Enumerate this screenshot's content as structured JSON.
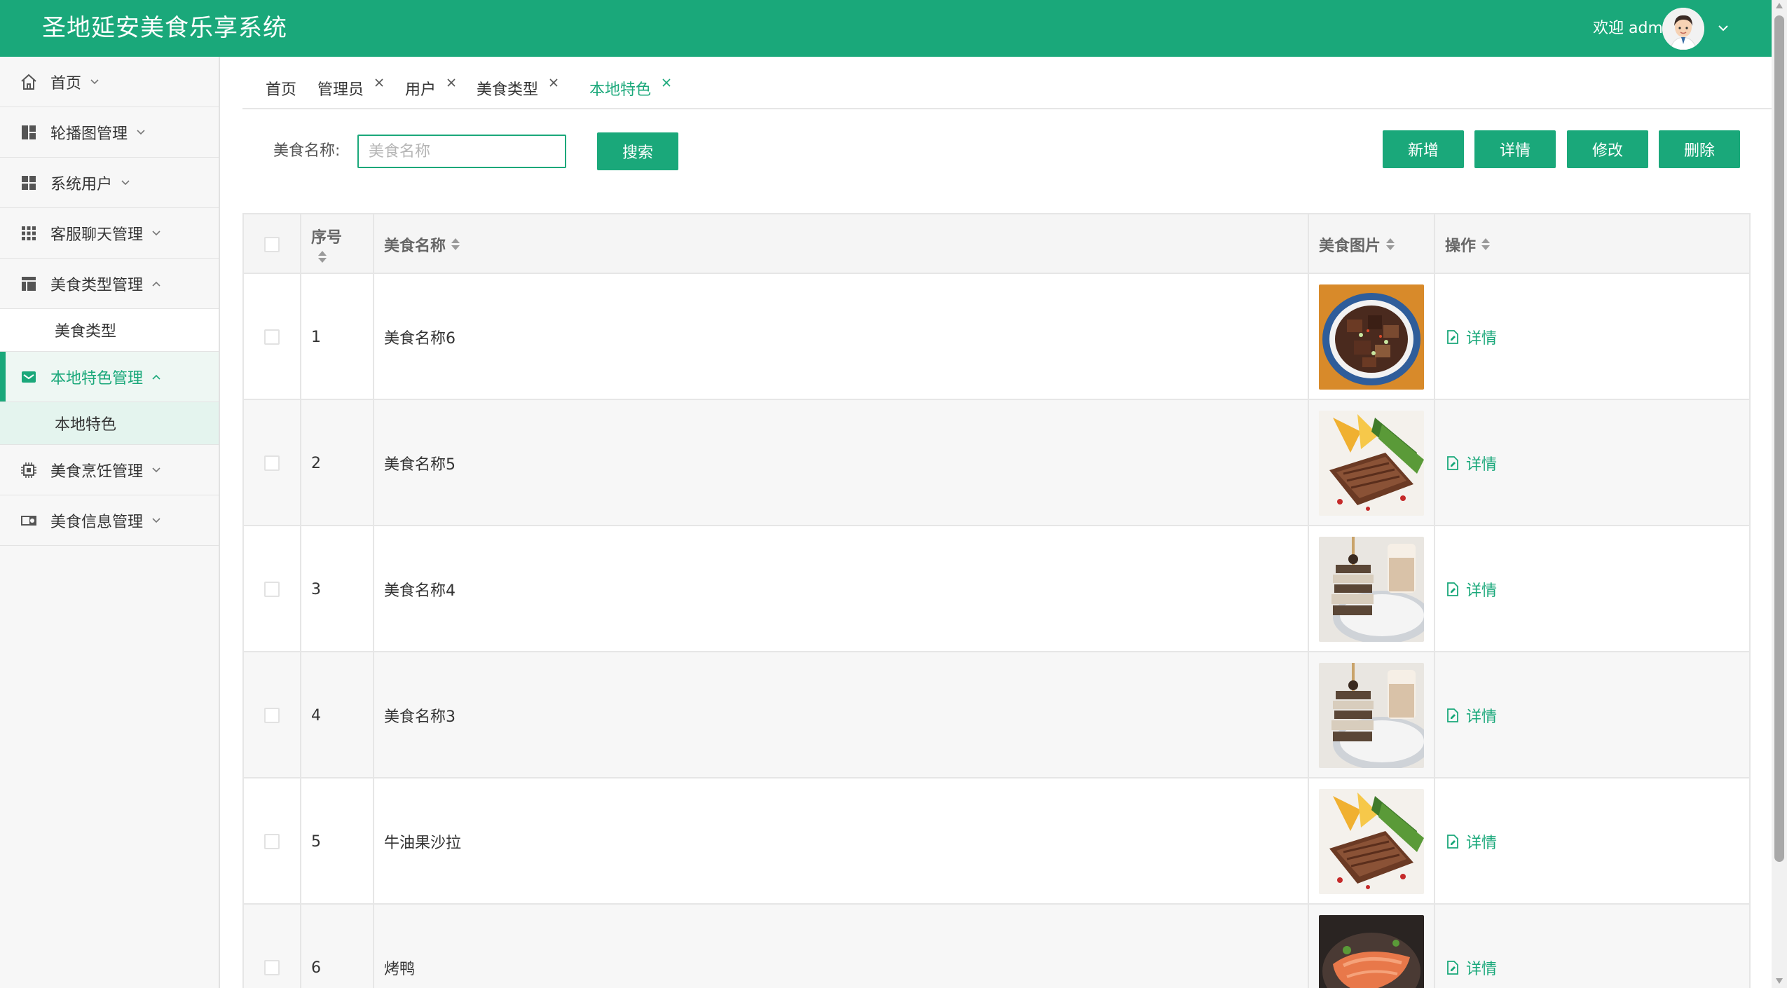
{
  "header": {
    "title": "圣地延安美食乐享系统",
    "welcome": "欢迎 admin",
    "brand_color": "#1aa87a"
  },
  "sidebar": {
    "items": [
      {
        "label": "首页",
        "icon": "home-icon",
        "expanded": false
      },
      {
        "label": "轮播图管理",
        "icon": "dashboard-icon",
        "expanded": false
      },
      {
        "label": "系统用户",
        "icon": "grid-icon",
        "expanded": false
      },
      {
        "label": "客服聊天管理",
        "icon": "apps-icon",
        "expanded": false
      },
      {
        "label": "美食类型管理",
        "icon": "layout-icon",
        "expanded": true,
        "children": [
          "美食类型"
        ]
      },
      {
        "label": "本地特色管理",
        "icon": "mail-icon",
        "expanded": true,
        "active": true,
        "children": [
          "本地特色"
        ]
      },
      {
        "label": "美食烹饪管理",
        "icon": "chip-icon",
        "expanded": false
      },
      {
        "label": "美食信息管理",
        "icon": "toggle-icon",
        "expanded": false
      }
    ]
  },
  "tabs": [
    {
      "label": "首页",
      "closable": false
    },
    {
      "label": "管理员",
      "closable": true
    },
    {
      "label": "用户",
      "closable": true
    },
    {
      "label": "美食类型",
      "closable": true
    },
    {
      "label": "本地特色",
      "closable": true,
      "active": true
    }
  ],
  "search": {
    "label": "美食名称:",
    "placeholder": "美食名称",
    "value": "",
    "button": "搜索"
  },
  "actions": {
    "add": "新增",
    "detail": "详情",
    "edit": "修改",
    "delete": "删除"
  },
  "table": {
    "columns": {
      "seq": "序号",
      "name": "美食名称",
      "image": "美食图片",
      "op": "操作"
    },
    "detail_label": "详情",
    "rows": [
      {
        "seq": "1",
        "name": "美食名称6",
        "image": "braised-meat-photo"
      },
      {
        "seq": "2",
        "name": "美食名称5",
        "image": "steak-photo"
      },
      {
        "seq": "3",
        "name": "美食名称4",
        "image": "dessert-photo"
      },
      {
        "seq": "4",
        "name": "美食名称3",
        "image": "dessert-photo"
      },
      {
        "seq": "5",
        "name": "牛油果沙拉",
        "image": "steak-photo"
      },
      {
        "seq": "6",
        "name": "烤鸭",
        "image": "salmon-photo"
      }
    ]
  }
}
